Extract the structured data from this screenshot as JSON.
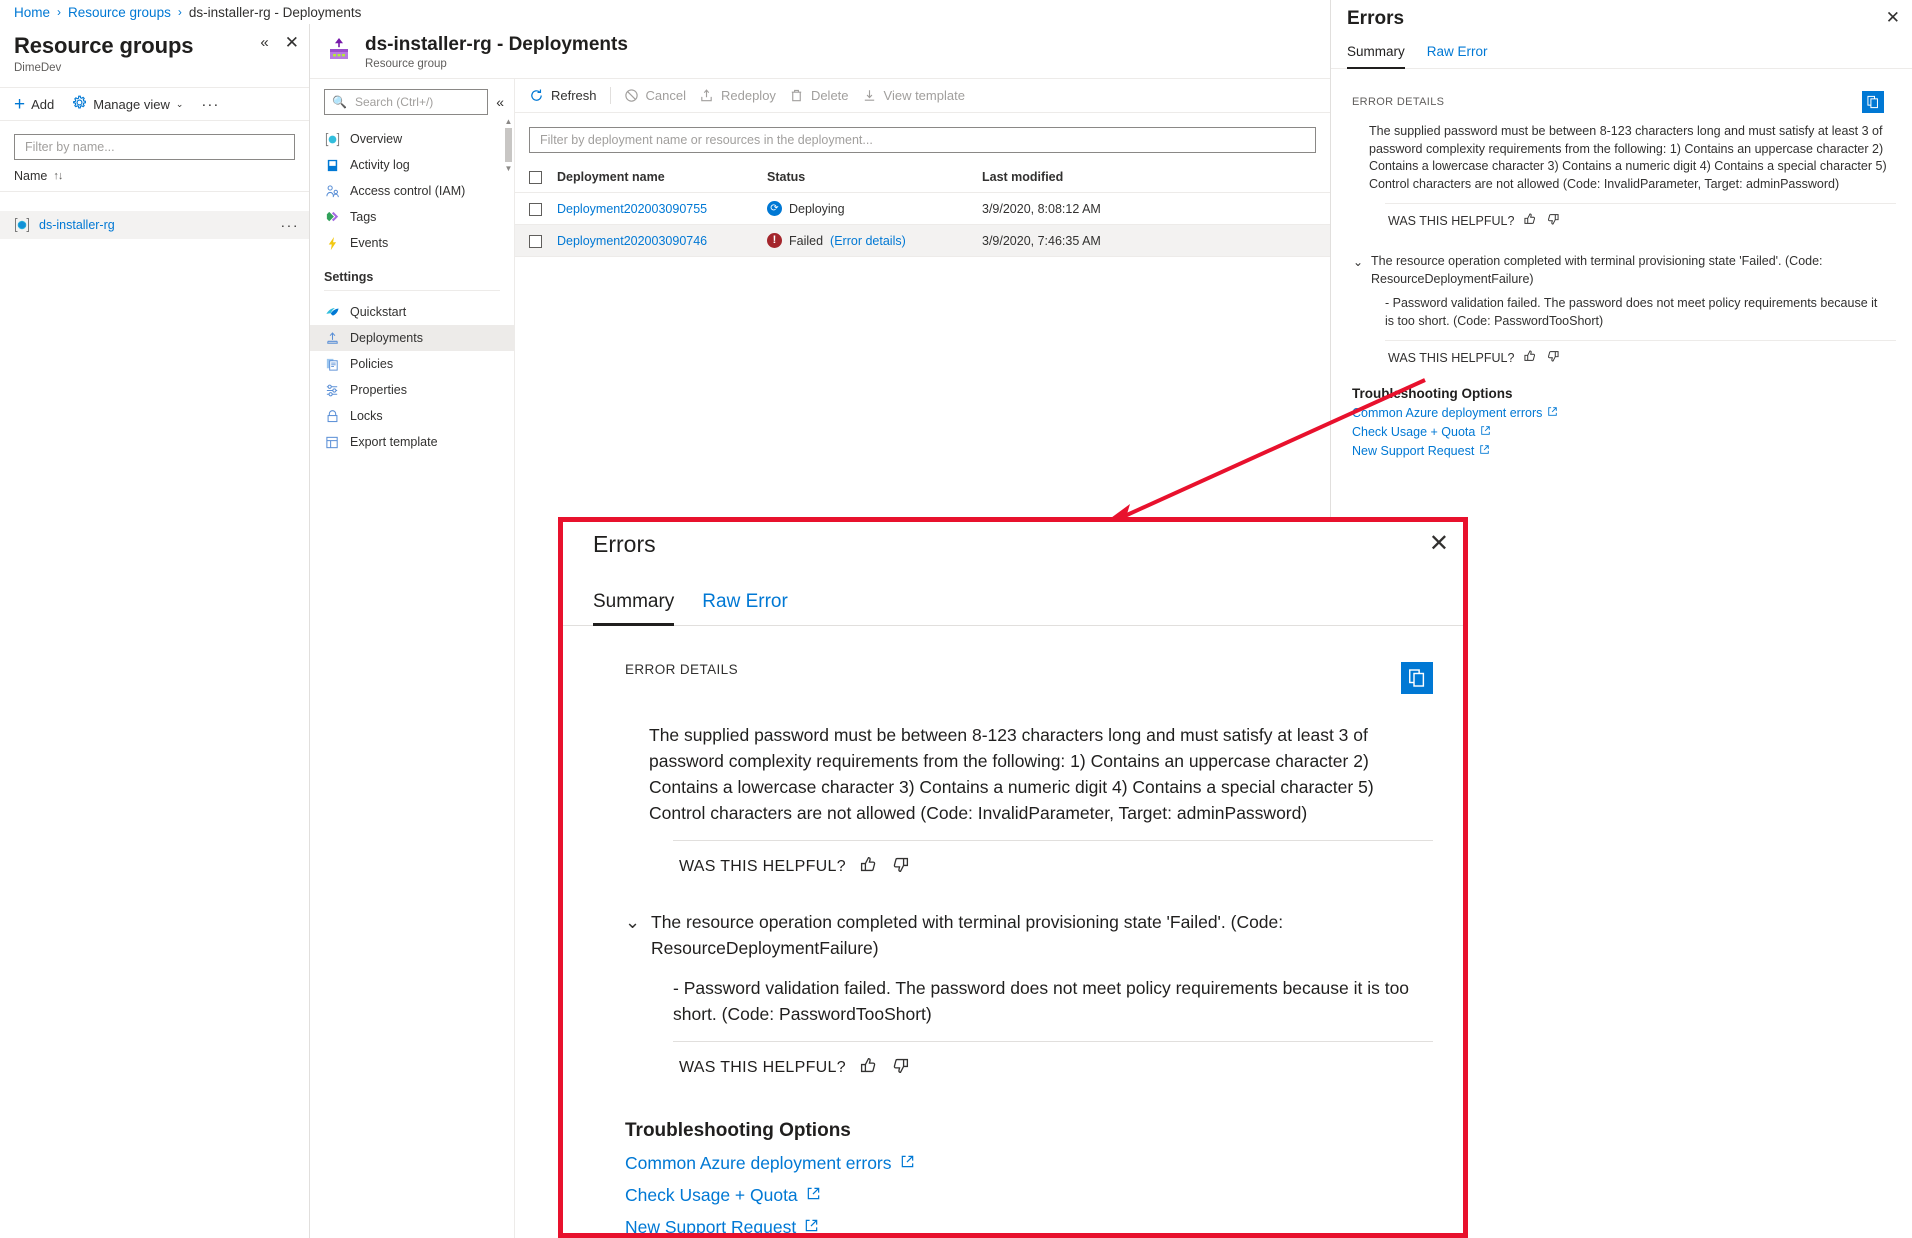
{
  "breadcrumb": {
    "home": "Home",
    "resource_groups": "Resource groups",
    "current": "ds-installer-rg - Deployments",
    "sep": "›"
  },
  "left_blade": {
    "title": "Resource groups",
    "subtitle": "DimeDev",
    "collapse_icon": "chevron-double-left-icon",
    "close_icon": "close-icon",
    "commands": [
      {
        "label": "Add",
        "icon": "plus-icon"
      },
      {
        "label": "Manage view",
        "icon": "gear-icon",
        "chevron": "⌄"
      },
      {
        "label": "···",
        "icon": "more-icon"
      }
    ],
    "filter_placeholder": "Filter by name...",
    "filter_value": "",
    "column_header": "Name",
    "sort_glyph": "↑↓",
    "rows": [
      {
        "name": "ds-installer-rg",
        "icon": "resource-group-icon",
        "more": "···"
      }
    ]
  },
  "mid_blade": {
    "title": "ds-installer-rg - Deployments",
    "subtitle": "Resource group",
    "search_placeholder": "Search (Ctrl+/)",
    "search_value": "",
    "collapse_icon": "chevron-double-left-icon",
    "nav_items": [
      {
        "label": "Overview",
        "icon": "overview-icon",
        "selected": false
      },
      {
        "label": "Activity log",
        "icon": "activity-log-icon",
        "selected": false
      },
      {
        "label": "Access control (IAM)",
        "icon": "access-control-icon",
        "selected": false
      },
      {
        "label": "Tags",
        "icon": "tags-icon",
        "selected": false
      },
      {
        "label": "Events",
        "icon": "events-icon",
        "selected": false
      }
    ],
    "settings_label": "Settings",
    "settings_items": [
      {
        "label": "Quickstart",
        "icon": "quickstart-icon",
        "selected": false
      },
      {
        "label": "Deployments",
        "icon": "deployments-icon",
        "selected": true
      },
      {
        "label": "Policies",
        "icon": "policies-icon",
        "selected": false
      },
      {
        "label": "Properties",
        "icon": "properties-icon",
        "selected": false
      },
      {
        "label": "Locks",
        "icon": "lock-icon",
        "selected": false
      },
      {
        "label": "Export template",
        "icon": "export-template-icon",
        "selected": false
      }
    ],
    "toolbar": [
      {
        "label": "Refresh",
        "icon": "refresh-icon",
        "enabled": true
      },
      {
        "label": "Cancel",
        "icon": "cancel-icon",
        "enabled": false
      },
      {
        "label": "Redeploy",
        "icon": "redeploy-icon",
        "enabled": false
      },
      {
        "label": "Delete",
        "icon": "delete-icon",
        "enabled": false
      },
      {
        "label": "View template",
        "icon": "view-template-icon",
        "enabled": false
      }
    ],
    "deployment_filter_placeholder": "Filter by deployment name or resources in the deployment...",
    "deployment_filter_value": "",
    "table": {
      "columns": [
        "Deployment name",
        "Status",
        "Last modified"
      ],
      "rows": [
        {
          "name": "Deployment202003090755",
          "status": "Deploying",
          "status_kind": "deploying",
          "error_link": "",
          "last_modified": "3/9/2020, 8:08:12 AM",
          "selected": false
        },
        {
          "name": "Deployment202003090746",
          "status": "Failed",
          "status_kind": "failed",
          "error_link": "(Error details)",
          "last_modified": "3/9/2020, 7:46:35 AM",
          "selected": true
        }
      ]
    }
  },
  "errors_panel": {
    "title": "Errors",
    "close_icon": "close-icon",
    "tabs": [
      {
        "label": "Summary",
        "active": true
      },
      {
        "label": "Raw Error",
        "active": false
      }
    ],
    "section_label": "ERROR DETAILS",
    "copy_icon": "copy-icon",
    "error1": "The supplied password must be between 8-123 characters long and must satisfy at least 3 of password complexity requirements from the following: 1) Contains an uppercase character 2) Contains a lowercase character 3) Contains a numeric digit 4) Contains a special character 5) Control characters are not allowed (Code: InvalidParameter, Target: adminPassword)",
    "helpful_label": "WAS THIS HELPFUL?",
    "thumbs_up_icon": "thumbs-up-icon",
    "thumbs_down_icon": "thumbs-down-icon",
    "error2": "The resource operation completed with terminal provisioning state 'Failed'. (Code: ResourceDeploymentFailure)",
    "error2_sub": "-  Password validation failed. The password does not meet policy requirements because it is too short. (Code: PasswordTooShort)",
    "expand_icon": "chevron-down-icon",
    "troubleshooting_title": "Troubleshooting Options",
    "troubleshooting_links": [
      {
        "label": "Common Azure deployment errors",
        "external_icon": "external-link-icon"
      },
      {
        "label": "Check Usage + Quota",
        "external_icon": "external-link-icon"
      },
      {
        "label": "New Support Request",
        "external_icon": "external-link-icon"
      }
    ]
  },
  "callout": {
    "border_color": "#e8112d",
    "arrow": "callout-pointer-arrow"
  }
}
